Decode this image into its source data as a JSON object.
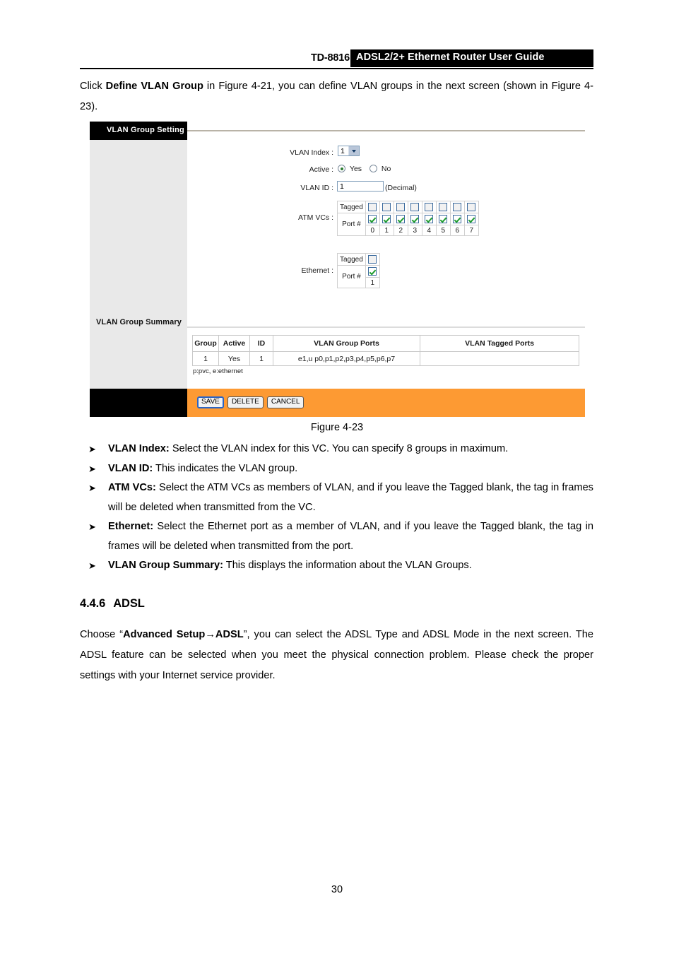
{
  "header": {
    "model": "TD-8816",
    "title": "ADSL2/2+  Ethernet  Router  User  Guide"
  },
  "intro": {
    "pre": "Click ",
    "bold": "Define VLAN Group",
    "post": " in Figure 4-21, you can define VLAN groups in the next screen (shown in Figure 4-23)."
  },
  "screenshot": {
    "sidebar": {
      "setting_title": "VLAN Group Setting",
      "summary_title": "VLAN Group Summary"
    },
    "form": {
      "vlan_index_label": "VLAN Index :",
      "vlan_index_value": "1",
      "active_label": "Active :",
      "active_yes": "Yes",
      "active_no": "No",
      "active_selected": "Yes",
      "vlan_id_label": "VLAN ID :",
      "vlan_id_value": "1",
      "vlan_id_hint": "(Decimal)",
      "atm_vcs_label": "ATM VCs :",
      "ethernet_label": "Ethernet :",
      "tagged_label": "Tagged",
      "port_label": "Port #",
      "atm_ports": [
        "0",
        "1",
        "2",
        "3",
        "4",
        "5",
        "6",
        "7"
      ],
      "atm_tagged_checked": [
        false,
        false,
        false,
        false,
        false,
        false,
        false,
        false
      ],
      "atm_port_checked": [
        true,
        true,
        true,
        true,
        true,
        true,
        true,
        true
      ],
      "eth_ports": [
        "1"
      ],
      "eth_tagged_checked": [
        false
      ],
      "eth_port_checked": [
        true
      ]
    },
    "summary": {
      "columns": [
        "Group",
        "Active",
        "ID",
        "VLAN Group Ports",
        "VLAN Tagged Ports"
      ],
      "rows": [
        [
          "1",
          "Yes",
          "1",
          "e1,u p0,p1,p2,p3,p4,p5,p6,p7",
          ""
        ]
      ],
      "note": "p:pvc, e:ethernet"
    },
    "buttons": [
      {
        "label": "SAVE",
        "focused": true
      },
      {
        "label": "DELETE",
        "focused": false
      },
      {
        "label": "CANCEL",
        "focused": false
      }
    ],
    "colors": {
      "footer_orange": "#fd9a33",
      "sidebar_gray": "#e9e9e9",
      "title_black": "#000000",
      "check_green": "#1e9c2e"
    }
  },
  "figure_caption": "Figure 4-23",
  "bullets": [
    {
      "marker": "➤",
      "term": "VLAN Index:",
      "text": " Select the VLAN index for this VC. You can specify 8 groups in maximum."
    },
    {
      "marker": "➤",
      "term": "VLAN ID:",
      "text": " This indicates the VLAN group."
    },
    {
      "marker": "➤",
      "term": "ATM VCs:",
      "text": " Select the ATM VCs as members of VLAN, and if you leave the Tagged blank, the tag in frames will be deleted when transmitted from the VC."
    },
    {
      "marker": "➤",
      "term": "Ethernet:",
      "text": " Select the Ethernet port as a member of VLAN, and if you leave the Tagged blank, the tag in frames will be deleted when transmitted from the port."
    },
    {
      "marker": "➤",
      "term": "VLAN Group Summary:",
      "text": " This displays the information about the VLAN Groups."
    }
  ],
  "section": {
    "number": "4.4.6",
    "title": "ADSL",
    "para_pre": "Choose “",
    "para_bold": "Advanced Setup→ADSL",
    "para_post": "”, you can select the ADSL Type and ADSL Mode in the next screen. The ADSL feature can be selected when you meet the physical connection problem. Please check the proper settings with your Internet service provider."
  },
  "page_number": "30"
}
